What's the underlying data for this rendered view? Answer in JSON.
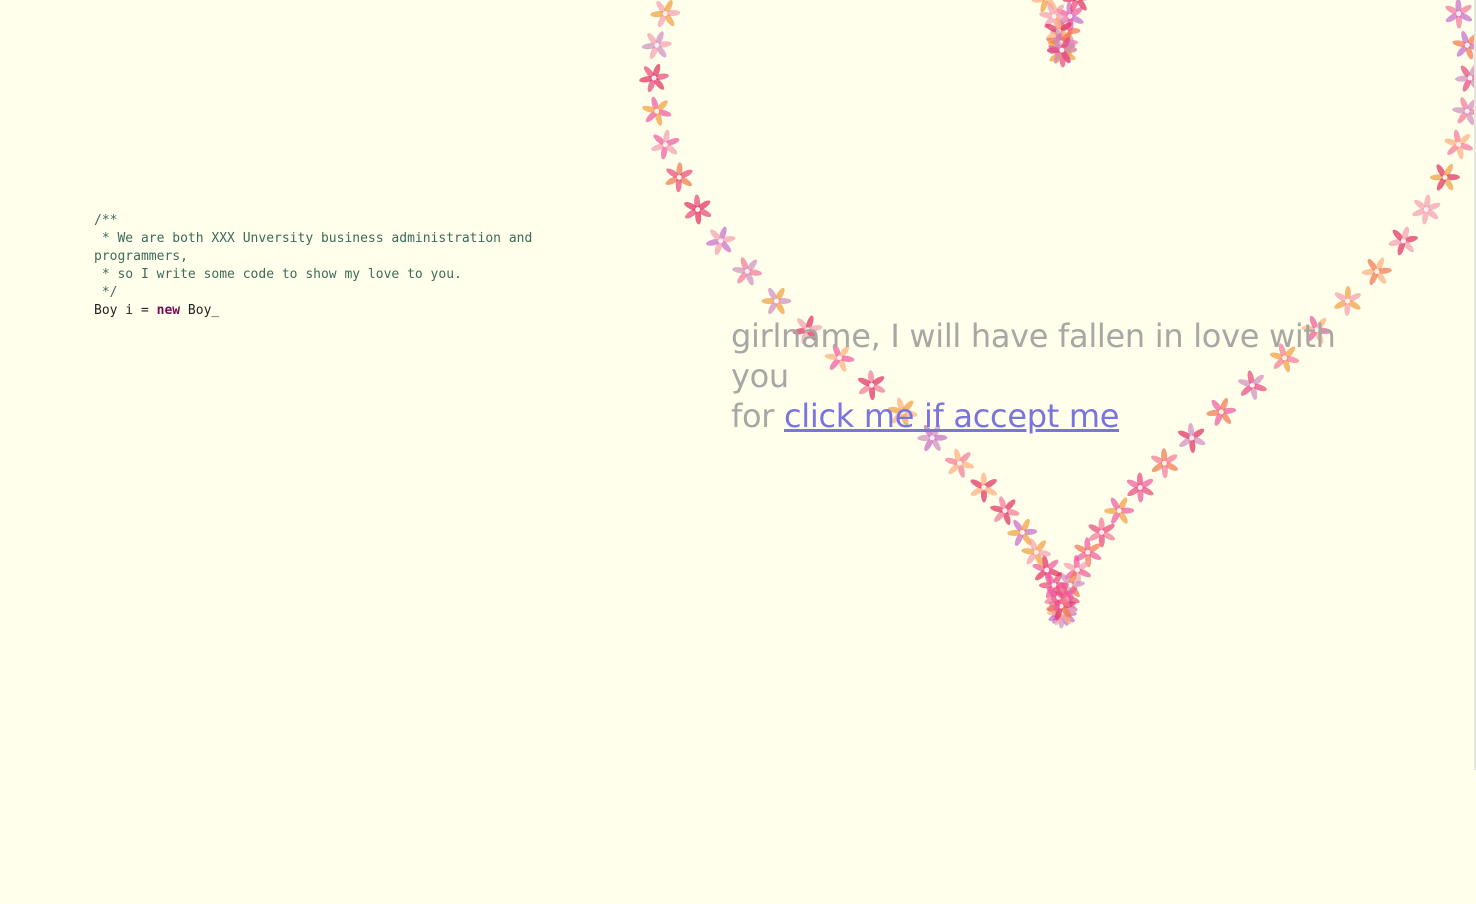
{
  "code": {
    "comment_lines": [
      "/**",
      " * We are both XXX Unversity business administration and programmers,",
      " * so I write some code to show my love to you.",
      " */"
    ],
    "code_prefix": "Boy i = ",
    "code_keyword": "new",
    "code_suffix": " Boy_"
  },
  "message": {
    "line1": "girlname, I will have fallen in love with you",
    "line2_prefix": "for ",
    "link_text": "click me if accept me"
  },
  "heart": {
    "flower_colors": [
      "#f05aa0",
      "#e84a7a",
      "#f07850",
      "#f4a0b0",
      "#c86ec8",
      "#f0a040",
      "#e03060",
      "#d090c0",
      "#f47a9a",
      "#ffb080"
    ]
  },
  "colors": {
    "background": "#ffffec",
    "message_text": "#a7a7a3",
    "link": "#7a74e0",
    "comment": "#3d6b5a",
    "keyword": "#7a0a4c"
  }
}
